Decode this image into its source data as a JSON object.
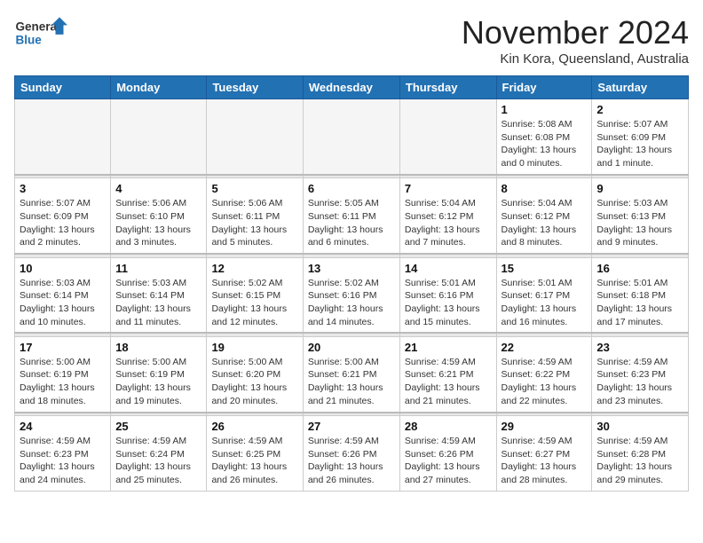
{
  "logo": {
    "general": "General",
    "blue": "Blue"
  },
  "title": "November 2024",
  "location": "Kin Kora, Queensland, Australia",
  "weekdays": [
    "Sunday",
    "Monday",
    "Tuesday",
    "Wednesday",
    "Thursday",
    "Friday",
    "Saturday"
  ],
  "weeks": [
    [
      {
        "day": "",
        "empty": true
      },
      {
        "day": "",
        "empty": true
      },
      {
        "day": "",
        "empty": true
      },
      {
        "day": "",
        "empty": true
      },
      {
        "day": "",
        "empty": true
      },
      {
        "day": "1",
        "sunrise": "5:08 AM",
        "sunset": "6:08 PM",
        "daylight": "13 hours and 0 minutes."
      },
      {
        "day": "2",
        "sunrise": "5:07 AM",
        "sunset": "6:09 PM",
        "daylight": "13 hours and 1 minute."
      }
    ],
    [
      {
        "day": "3",
        "sunrise": "5:07 AM",
        "sunset": "6:09 PM",
        "daylight": "13 hours and 2 minutes."
      },
      {
        "day": "4",
        "sunrise": "5:06 AM",
        "sunset": "6:10 PM",
        "daylight": "13 hours and 3 minutes."
      },
      {
        "day": "5",
        "sunrise": "5:06 AM",
        "sunset": "6:11 PM",
        "daylight": "13 hours and 5 minutes."
      },
      {
        "day": "6",
        "sunrise": "5:05 AM",
        "sunset": "6:11 PM",
        "daylight": "13 hours and 6 minutes."
      },
      {
        "day": "7",
        "sunrise": "5:04 AM",
        "sunset": "6:12 PM",
        "daylight": "13 hours and 7 minutes."
      },
      {
        "day": "8",
        "sunrise": "5:04 AM",
        "sunset": "6:12 PM",
        "daylight": "13 hours and 8 minutes."
      },
      {
        "day": "9",
        "sunrise": "5:03 AM",
        "sunset": "6:13 PM",
        "daylight": "13 hours and 9 minutes."
      }
    ],
    [
      {
        "day": "10",
        "sunrise": "5:03 AM",
        "sunset": "6:14 PM",
        "daylight": "13 hours and 10 minutes."
      },
      {
        "day": "11",
        "sunrise": "5:03 AM",
        "sunset": "6:14 PM",
        "daylight": "13 hours and 11 minutes."
      },
      {
        "day": "12",
        "sunrise": "5:02 AM",
        "sunset": "6:15 PM",
        "daylight": "13 hours and 12 minutes."
      },
      {
        "day": "13",
        "sunrise": "5:02 AM",
        "sunset": "6:16 PM",
        "daylight": "13 hours and 14 minutes."
      },
      {
        "day": "14",
        "sunrise": "5:01 AM",
        "sunset": "6:16 PM",
        "daylight": "13 hours and 15 minutes."
      },
      {
        "day": "15",
        "sunrise": "5:01 AM",
        "sunset": "6:17 PM",
        "daylight": "13 hours and 16 minutes."
      },
      {
        "day": "16",
        "sunrise": "5:01 AM",
        "sunset": "6:18 PM",
        "daylight": "13 hours and 17 minutes."
      }
    ],
    [
      {
        "day": "17",
        "sunrise": "5:00 AM",
        "sunset": "6:19 PM",
        "daylight": "13 hours and 18 minutes."
      },
      {
        "day": "18",
        "sunrise": "5:00 AM",
        "sunset": "6:19 PM",
        "daylight": "13 hours and 19 minutes."
      },
      {
        "day": "19",
        "sunrise": "5:00 AM",
        "sunset": "6:20 PM",
        "daylight": "13 hours and 20 minutes."
      },
      {
        "day": "20",
        "sunrise": "5:00 AM",
        "sunset": "6:21 PM",
        "daylight": "13 hours and 21 minutes."
      },
      {
        "day": "21",
        "sunrise": "4:59 AM",
        "sunset": "6:21 PM",
        "daylight": "13 hours and 21 minutes."
      },
      {
        "day": "22",
        "sunrise": "4:59 AM",
        "sunset": "6:22 PM",
        "daylight": "13 hours and 22 minutes."
      },
      {
        "day": "23",
        "sunrise": "4:59 AM",
        "sunset": "6:23 PM",
        "daylight": "13 hours and 23 minutes."
      }
    ],
    [
      {
        "day": "24",
        "sunrise": "4:59 AM",
        "sunset": "6:23 PM",
        "daylight": "13 hours and 24 minutes."
      },
      {
        "day": "25",
        "sunrise": "4:59 AM",
        "sunset": "6:24 PM",
        "daylight": "13 hours and 25 minutes."
      },
      {
        "day": "26",
        "sunrise": "4:59 AM",
        "sunset": "6:25 PM",
        "daylight": "13 hours and 26 minutes."
      },
      {
        "day": "27",
        "sunrise": "4:59 AM",
        "sunset": "6:26 PM",
        "daylight": "13 hours and 26 minutes."
      },
      {
        "day": "28",
        "sunrise": "4:59 AM",
        "sunset": "6:26 PM",
        "daylight": "13 hours and 27 minutes."
      },
      {
        "day": "29",
        "sunrise": "4:59 AM",
        "sunset": "6:27 PM",
        "daylight": "13 hours and 28 minutes."
      },
      {
        "day": "30",
        "sunrise": "4:59 AM",
        "sunset": "6:28 PM",
        "daylight": "13 hours and 29 minutes."
      }
    ]
  ]
}
